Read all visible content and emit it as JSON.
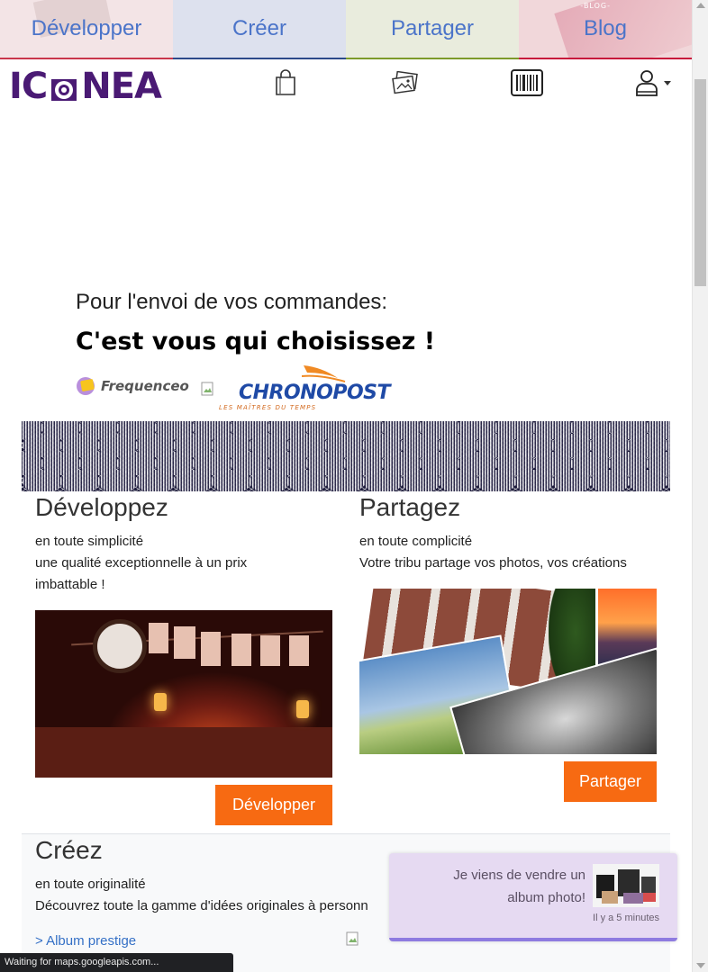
{
  "top_tabs": [
    {
      "label": "Développer"
    },
    {
      "label": "Créer"
    },
    {
      "label": "Partager"
    },
    {
      "label": "Blog"
    }
  ],
  "header": {
    "logo_text_left": "IC",
    "logo_text_right": "NEA",
    "icons": [
      "shopping-bag-icon",
      "photos-icon",
      "barcode-icon",
      "user-account-icon",
      "caret-down-icon"
    ]
  },
  "shipping": {
    "intro": "Pour l'envoi de vos commandes:",
    "headline": "C'est vous qui choisissez !",
    "frequenceo_label": "Frequenceo",
    "chronopost_label": "CHRONOPOST",
    "chronopost_tagline": "LES MAÎTRES DU TEMPS"
  },
  "features": {
    "develop": {
      "title": "Développez",
      "line1": "en toute simplicité",
      "line2": "une qualité exceptionnelle à un prix",
      "line3": "imbattable !",
      "button": "Développer"
    },
    "share": {
      "title": "Partagez",
      "line1": "en toute complicité",
      "line2": "Votre tribu partage vos photos, vos créations",
      "button": "Partager"
    },
    "create": {
      "title": "Créez",
      "line1": "en toute originalité",
      "line2": "Découvrez toute la gamme d'idées originales à personn",
      "link1": "> Album prestige"
    }
  },
  "toast": {
    "message": "Je viens de vendre un album photo!",
    "time": "Il y a 5 minutes"
  },
  "status_bar": {
    "text": "Waiting for maps.googleapis.com..."
  },
  "colors": {
    "accent_orange": "#f76a12",
    "link_blue": "#3470c6",
    "tab_text": "#4b74c9",
    "logo_purple": "#4a1a74"
  }
}
